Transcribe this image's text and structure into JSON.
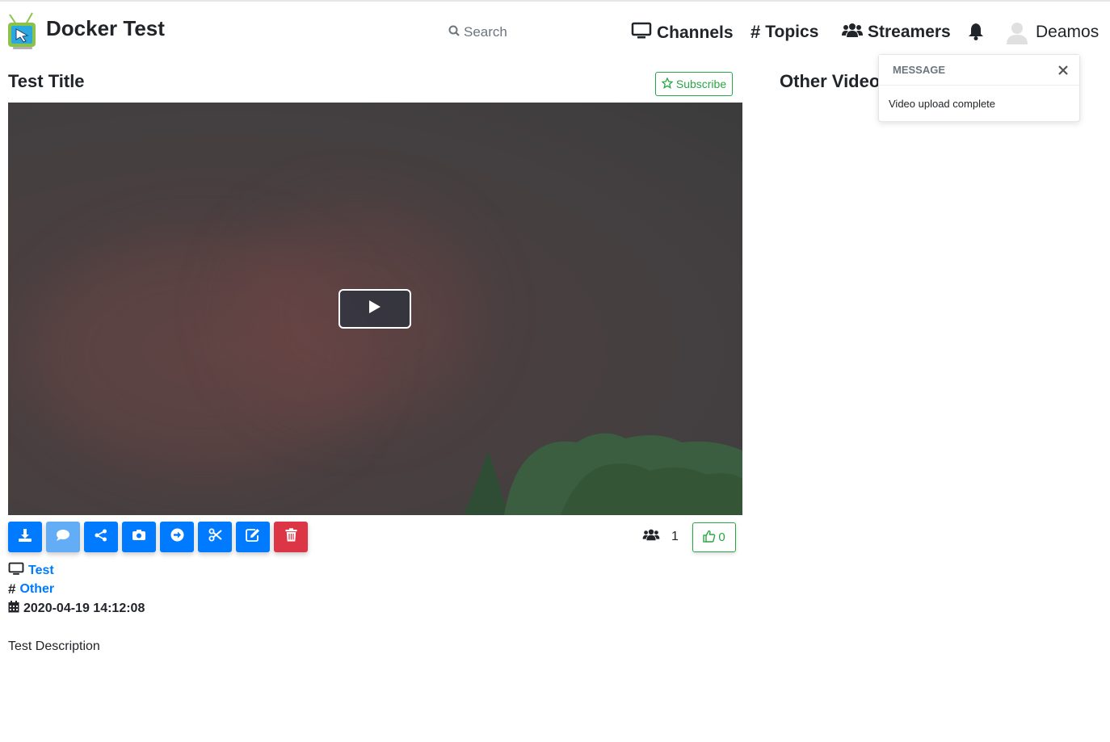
{
  "app": {
    "title": "Docker Test"
  },
  "search": {
    "placeholder": "Search"
  },
  "nav": {
    "channels": "Channels",
    "topics": "Topics",
    "streamers": "Streamers",
    "username": "Deamos"
  },
  "video": {
    "title": "Test Title",
    "subscribe_label": "Subscribe",
    "viewer_count": "1",
    "like_count": "0",
    "channel": "Test",
    "topic": "Other",
    "date": "2020-04-19 14:12:08",
    "description": "Test Description"
  },
  "toolbar": {
    "buttons": [
      "download-icon",
      "comment-icon",
      "share-icon",
      "camera-icon",
      "arrow-right-icon",
      "scissors-icon",
      "edit-icon",
      "trash-icon"
    ]
  },
  "sidebar": {
    "title": "Other Videos"
  },
  "toast": {
    "header": "MESSAGE",
    "body": "Video upload complete"
  },
  "colors": {
    "primary": "#007bff",
    "success": "#28a745",
    "danger": "#dc3545"
  }
}
